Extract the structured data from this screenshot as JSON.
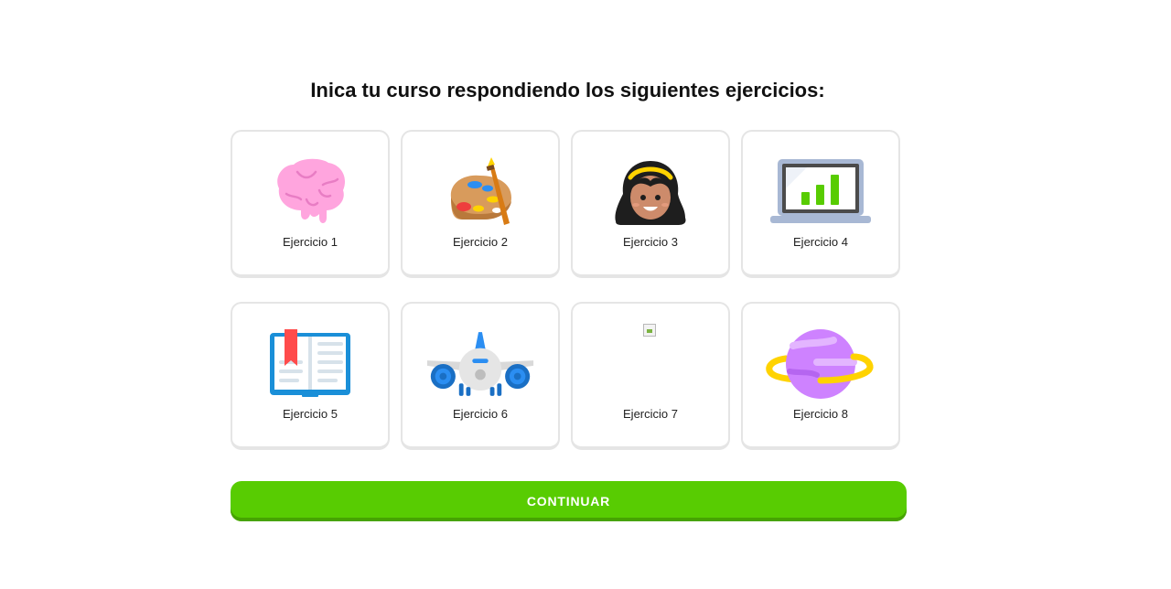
{
  "heading": "Inica tu curso respondiendo los siguientes ejercicios:",
  "exercises": [
    {
      "label": "Ejercicio 1",
      "icon": "brain-icon"
    },
    {
      "label": "Ejercicio 2",
      "icon": "palette-icon"
    },
    {
      "label": "Ejercicio 3",
      "icon": "person-icon"
    },
    {
      "label": "Ejercicio 4",
      "icon": "laptop-chart-icon"
    },
    {
      "label": "Ejercicio 5",
      "icon": "book-icon"
    },
    {
      "label": "Ejercicio 6",
      "icon": "airplane-icon"
    },
    {
      "label": "Ejercicio 7",
      "icon": "broken-image-icon"
    },
    {
      "label": "Ejercicio 8",
      "icon": "planet-icon"
    }
  ],
  "continue_button": {
    "label": "CONTINUAR"
  },
  "colors": {
    "accent": "#58cc02",
    "accent_shadow": "#46a302",
    "card_border": "#e5e5e5"
  }
}
